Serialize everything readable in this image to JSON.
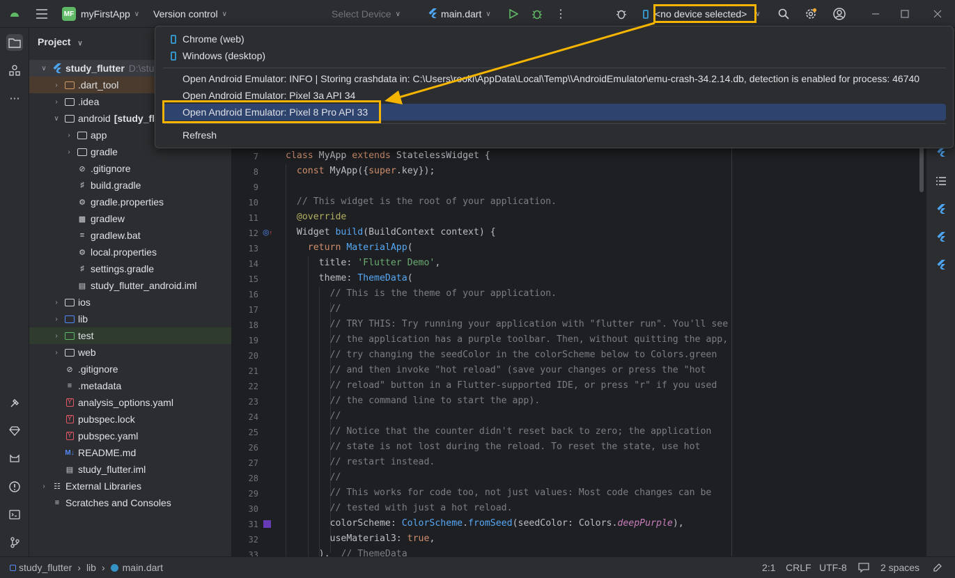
{
  "titlebar": {
    "project_badge": "MF",
    "project_name": "myFirstApp",
    "vcs": "Version control",
    "device_placeholder": "Select Device",
    "run_config": "main.dart",
    "device_selector": "<no device selected>"
  },
  "project_panel": {
    "title": "Project",
    "tree": [
      {
        "label": "study_flutter",
        "extra": "D:\\stud"
      },
      {
        "label": ".dart_tool"
      },
      {
        "label": ".idea"
      },
      {
        "label": "android",
        "extra": "[study_flu"
      },
      {
        "label": "app"
      },
      {
        "label": "gradle"
      },
      {
        "label": ".gitignore"
      },
      {
        "label": "build.gradle"
      },
      {
        "label": "gradle.properties"
      },
      {
        "label": "gradlew"
      },
      {
        "label": "gradlew.bat"
      },
      {
        "label": "local.properties"
      },
      {
        "label": "settings.gradle"
      },
      {
        "label": "study_flutter_android.iml"
      },
      {
        "label": "ios"
      },
      {
        "label": "lib"
      },
      {
        "label": "test"
      },
      {
        "label": "web"
      },
      {
        "label": ".gitignore"
      },
      {
        "label": ".metadata"
      },
      {
        "label": "analysis_options.yaml"
      },
      {
        "label": "pubspec.lock"
      },
      {
        "label": "pubspec.yaml"
      },
      {
        "label": "README.md"
      },
      {
        "label": "study_flutter.iml"
      },
      {
        "label": "External Libraries"
      },
      {
        "label": "Scratches and Consoles"
      }
    ]
  },
  "dropdown": {
    "items": [
      "Chrome (web)",
      "Windows (desktop)",
      "Open Android Emulator: INFO    | Storing crashdata in: C:\\Users\\rooki\\AppData\\Local\\Temp\\\\AndroidEmulator\\emu-crash-34.2.14.db, detection is enabled for process: 46740",
      "Open Android Emulator: Pixel 3a API 34",
      "Open Android Emulator: Pixel 8 Pro API 33",
      "Refresh"
    ]
  },
  "editor": {
    "line_numbers": [
      "7",
      "8",
      "9",
      "10",
      "11",
      "12",
      "13",
      "14",
      "15",
      "16",
      "17",
      "18",
      "19",
      "20",
      "21",
      "22",
      "23",
      "24",
      "25",
      "26",
      "27",
      "28",
      "29",
      "30",
      "31",
      "32",
      "33"
    ],
    "code": {
      "l7a": "class ",
      "l7b": "MyApp ",
      "l7c": "extends ",
      "l7d": "StatelessWidget {",
      "l8a": "  const ",
      "l8b": "MyApp({",
      "l8c": "super",
      "l8d": ".key});",
      "l10": "  // This widget is the root of your application.",
      "l11": "  @override",
      "l12a": "  Widget ",
      "l12b": "build",
      "l12c": "(BuildContext context) {",
      "l13a": "    return ",
      "l13b": "MaterialApp",
      "l13c": "(",
      "l14a": "      title: ",
      "l14b": "'Flutter Demo'",
      "l14c": ",",
      "l15a": "      theme: ",
      "l15b": "ThemeData",
      "l15c": "(",
      "l16": "        // This is the theme of your application.",
      "l17": "        //",
      "l18": "        // TRY THIS: Try running your application with \"flutter run\". You'll see",
      "l19": "        // the application has a purple toolbar. Then, without quitting the app,",
      "l20": "        // try changing the seedColor in the colorScheme below to Colors.green",
      "l21": "        // and then invoke \"hot reload\" (save your changes or press the \"hot",
      "l22": "        // reload\" button in a Flutter-supported IDE, or press \"r\" if you used",
      "l23": "        // the command line to start the app).",
      "l24": "        //",
      "l25": "        // Notice that the counter didn't reset back to zero; the application",
      "l26": "        // state is not lost during the reload. To reset the state, use hot",
      "l27": "        // restart instead.",
      "l28": "        //",
      "l29": "        // This works for code too, not just values: Most code changes can be",
      "l30": "        // tested with just a hot reload.",
      "l31a": "        colorScheme: ",
      "l31b": "ColorScheme",
      "l31c": ".",
      "l31d": "fromSeed",
      "l31e": "(seedColor: Colors.",
      "l31f": "deepPurple",
      "l31g": "),",
      "l32a": "        useMaterial3: ",
      "l32b": "true",
      "l32c": ",",
      "l33a": "      ),  ",
      "l33b": "// ThemeData"
    }
  },
  "statusbar": {
    "breadcrumb": [
      "study_flutter",
      "lib",
      "main.dart"
    ],
    "position": "2:1",
    "line_sep": "CRLF",
    "encoding": "UTF-8",
    "indent": "2 spaces"
  },
  "colors": {
    "accent": "#f5b400",
    "selection": "#2e436e",
    "flutter_blue": "#4ea5f2",
    "bg": "#1e1f22",
    "panel": "#2b2d30"
  }
}
